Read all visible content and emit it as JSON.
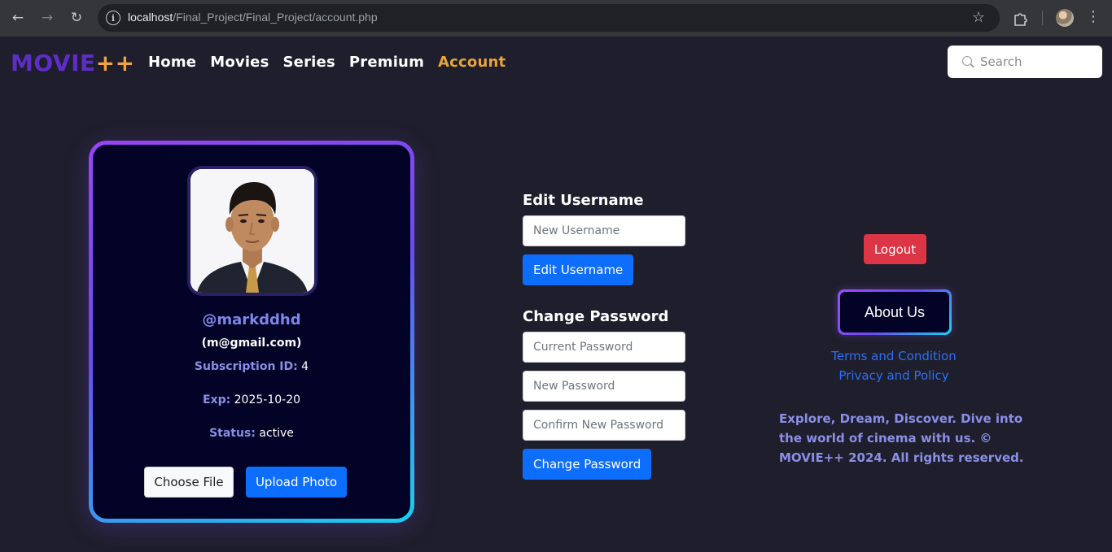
{
  "browser": {
    "url_host": "localhost",
    "url_path": "/Final_Project/Final_Project/account.php"
  },
  "site": {
    "logo_main": "MOVIE",
    "logo_plus": "++",
    "nav": [
      {
        "label": "Home",
        "active": false
      },
      {
        "label": "Movies",
        "active": false
      },
      {
        "label": "Series",
        "active": false
      },
      {
        "label": "Premium",
        "active": false
      },
      {
        "label": "Account",
        "active": true
      }
    ],
    "search_placeholder": "Search",
    "accent_color": "#e7a43a",
    "brand_color": "#5e2dc7"
  },
  "profile": {
    "username": "@markddhd",
    "email": "(m@gmail.com)",
    "subscription_label": "Subscription ID:",
    "subscription_value": "4",
    "exp_label": "Exp:",
    "exp_value": "2025-10-20",
    "status_label": "Status:",
    "status_value": "active",
    "choose_file_label": "Choose File",
    "upload_label": "Upload Photo"
  },
  "edit_username": {
    "title": "Edit Username",
    "new_username_placeholder": "New Username",
    "submit_label": "Edit Username"
  },
  "change_password": {
    "title": "Change Password",
    "current_placeholder": "Current Password",
    "new_placeholder": "New Password",
    "confirm_placeholder": "Confirm New Password",
    "submit_label": "Change Password"
  },
  "sidebar": {
    "logout_label": "Logout",
    "about_label": "About Us",
    "terms_label": "Terms and Condition",
    "privacy_label": "Privacy and Policy",
    "tagline": "Explore, Dream, Discover. Dive into the world of cinema with us. © MOVIE++ 2024. All rights reserved."
  }
}
